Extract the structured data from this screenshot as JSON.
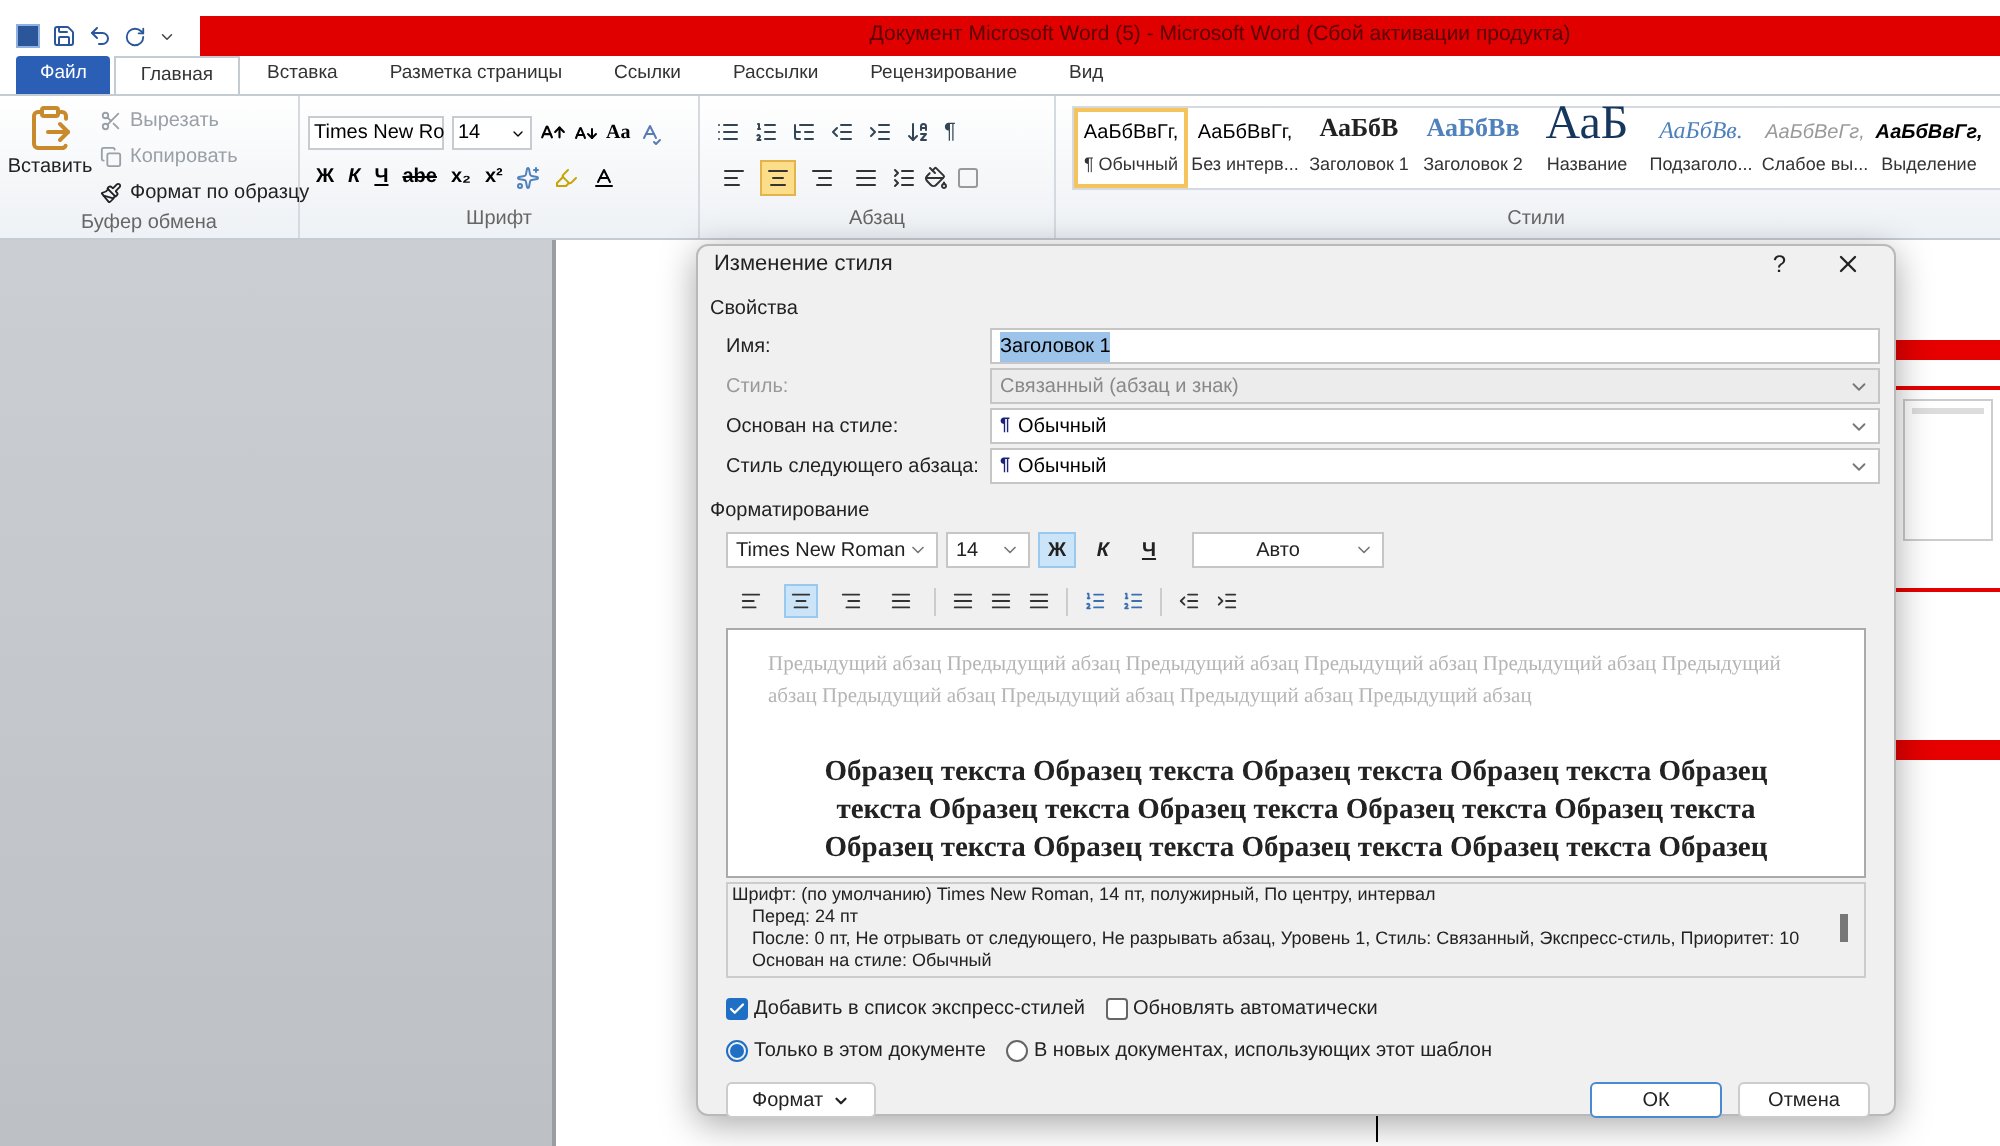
{
  "window": {
    "title": "Документ Microsoft Word (5)  -  Microsoft Word (Сбой активации продукта)"
  },
  "tabs": [
    {
      "label": "Файл",
      "kind": "file",
      "selected": false
    },
    {
      "label": "Главная",
      "kind": "tab",
      "selected": true
    },
    {
      "label": "Вставка",
      "kind": "tab",
      "selected": false
    },
    {
      "label": "Разметка страницы",
      "kind": "tab",
      "selected": false
    },
    {
      "label": "Ссылки",
      "kind": "tab",
      "selected": false
    },
    {
      "label": "Рассылки",
      "kind": "tab",
      "selected": false
    },
    {
      "label": "Рецензирование",
      "kind": "tab",
      "selected": false
    },
    {
      "label": "Вид",
      "kind": "tab",
      "selected": false
    }
  ],
  "ribbon": {
    "clipboard": {
      "label": "Буфер обмена",
      "paste": "Вставить",
      "items": [
        {
          "label": "Вырезать",
          "disabled": true
        },
        {
          "label": "Копировать",
          "disabled": true
        },
        {
          "label": "Формат по образцу",
          "disabled": false
        }
      ]
    },
    "font": {
      "label": "Шрифт",
      "font": "Times New Ro",
      "size": "14",
      "case_button": "Aa",
      "format_buttons": [
        "Ж",
        "К",
        "Ч",
        "abe",
        "x₂",
        "x²"
      ]
    },
    "paragraph": {
      "label": "Абзац",
      "pilcrow": "¶",
      "align": [
        {
          "kind": "left",
          "selected": false
        },
        {
          "kind": "center",
          "selected": true
        },
        {
          "kind": "right",
          "selected": false
        },
        {
          "kind": "justify",
          "selected": false
        }
      ]
    },
    "styles": {
      "label": "Стили",
      "items": [
        {
          "sample": "АаБбВвГг,",
          "label": "¶ Обычный",
          "kind": "normal",
          "selected": true
        },
        {
          "sample": "АаБбВвГг,",
          "label": "Без интерв...",
          "kind": "normal",
          "selected": false
        },
        {
          "sample": "АаБбВ",
          "label": "Заголовок 1",
          "kind": "heading1",
          "selected": false
        },
        {
          "sample": "АаБбВв",
          "label": "Заголовок 2",
          "kind": "heading2",
          "selected": false
        },
        {
          "sample": "АаБ",
          "label": "Название",
          "kind": "title",
          "selected": false
        },
        {
          "sample": "АаБбВв.",
          "label": "Подзаголо...",
          "kind": "subtitle",
          "selected": false
        },
        {
          "sample": "АаБбВеГг,",
          "label": "Слабое вы...",
          "kind": "subtle",
          "selected": false
        },
        {
          "sample": "АаБбВвГг,",
          "label": "Выделение",
          "kind": "emphasis",
          "selected": false
        }
      ]
    }
  },
  "dialog": {
    "title": "Изменение стиля",
    "help": "?",
    "properties_label": "Свойства",
    "properties": [
      {
        "label": "Имя:",
        "value": "Заголовок 1",
        "kind": "text",
        "disabled": false
      },
      {
        "label": "Стиль:",
        "value": "Связанный (абзац и знак)",
        "kind": "select",
        "disabled": true
      },
      {
        "label": "Основан на стиле:",
        "value": "Обычный",
        "kind": "select",
        "disabled": false,
        "mark": "¶"
      },
      {
        "label": "Стиль следующего абзаца:",
        "value": "Обычный",
        "kind": "select",
        "disabled": false,
        "mark": "¶"
      }
    ],
    "formatting_label": "Форматирование",
    "font": "Times New Roman",
    "size": "14",
    "styles": [
      {
        "label": "Ж",
        "kind": "bold",
        "selected": true
      },
      {
        "label": "К",
        "kind": "italic",
        "selected": false
      },
      {
        "label": "Ч",
        "kind": "underline",
        "selected": false
      }
    ],
    "font_color": "Авто",
    "align": [
      {
        "kind": "left",
        "selected": false
      },
      {
        "kind": "center",
        "selected": true
      },
      {
        "kind": "right",
        "selected": false
      },
      {
        "kind": "justify",
        "selected": false
      }
    ],
    "preview_previous": "Предыдущий абзац Предыдущий абзац Предыдущий абзац Предыдущий абзац Предыдущий абзац Предыдущий абзац Предыдущий абзац Предыдущий абзац Предыдущий абзац Предыдущий абзац",
    "preview_sample": [
      "Образец текста Образец текста Образец текста Образец текста Образец",
      "текста Образец текста Образец текста Образец текста Образец текста",
      "Образец текста Образец текста Образец текста Образец текста Образец"
    ],
    "description": [
      "Шрифт: (по умолчанию) Times New Roman, 14 пт, полужирный, По центру, интервал",
      "Перед:  24 пт",
      "После:  0 пт, Не отрывать от следующего, Не разрывать абзац, Уровень 1, Стиль: Связанный, Экспресс-стиль, Приоритет: 10",
      "Основан на стиле: Обычный"
    ],
    "checkboxes": [
      {
        "label": "Добавить в список экспресс-стилей",
        "checked": true
      },
      {
        "label": "Обновлять автоматически",
        "checked": false
      }
    ],
    "radios": [
      {
        "label": "Только в этом документе",
        "selected": true
      },
      {
        "label": "В новых документах, использующих этот шаблон",
        "selected": false
      }
    ],
    "format_button": "Формат",
    "ok": "ОК",
    "cancel": "Отмена"
  }
}
